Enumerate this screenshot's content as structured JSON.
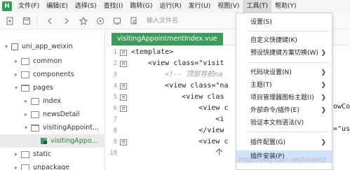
{
  "menubar": {
    "logo": "H",
    "items": [
      "文件(F)",
      "编辑(E)",
      "选择(S)",
      "查找(I)",
      "跳转(G)",
      "运行(R)",
      "发行(U)",
      "视图(V)",
      "工具(T)",
      "帮助(Y)"
    ]
  },
  "toolbar": {
    "search_placeholder": "输入文件名"
  },
  "sidebar": {
    "items": [
      {
        "label": "uni_app_weixin",
        "arrow": "▾",
        "icon": "project"
      },
      {
        "label": "common",
        "arrow": "▸",
        "icon": "folder"
      },
      {
        "label": "components",
        "arrow": "▸",
        "icon": "folder"
      },
      {
        "label": "pages",
        "arrow": "▾",
        "icon": "folder-open"
      },
      {
        "label": "index",
        "arrow": "▸",
        "icon": "folder"
      },
      {
        "label": "newsDetail",
        "arrow": "▸",
        "icon": "folder"
      },
      {
        "label": "visitingAppoint...",
        "arrow": "▾",
        "icon": "folder-open"
      },
      {
        "label": "visitingAppo...",
        "arrow": "",
        "icon": "vue-file"
      },
      {
        "label": "static",
        "arrow": "▸",
        "icon": "folder"
      },
      {
        "label": "unpackage",
        "arrow": "▸",
        "icon": "folder"
      }
    ]
  },
  "editor": {
    "tab_label": "visitingAppointmentIndex.vue",
    "lines": [
      {
        "num": "1",
        "fold": "⊟",
        "text": "<template>",
        "comment": false
      },
      {
        "num": "2",
        "fold": "⊟",
        "text": "    <view class=\"visit",
        "comment": false
      },
      {
        "num": "3",
        "fold": "",
        "text": "        <!-- 顶部导航na",
        "comment": true
      },
      {
        "num": "4",
        "fold": "⊟",
        "text": "        <view class=\"na",
        "comment": false
      },
      {
        "num": "5",
        "fold": "⊟",
        "text": "            <view clas",
        "comment": false
      },
      {
        "num": "6",
        "fold": "⊟",
        "text": "                <view c",
        "comment": false
      },
      {
        "num": "7",
        "fold": "",
        "text": "                    <i",
        "comment": false
      },
      {
        "num": "8",
        "fold": "",
        "text": "                </view",
        "comment": false
      },
      {
        "num": "9",
        "fold": "⊟",
        "text": "                <view c",
        "comment": false
      },
      {
        "num": "10",
        "fold": "",
        "text": "                    个",
        "comment": false
      }
    ],
    "right_clip_1": "owCo",
    "right_clip_2": "=\"us"
  },
  "dropdown": {
    "items": [
      {
        "label": "设置(S)",
        "submenu": false
      },
      {
        "label": "自定义快捷键(K)",
        "submenu": false
      },
      {
        "label": "预设快捷键方案切换(W)",
        "submenu": true
      },
      {
        "label": "代码块设置(N)",
        "submenu": true
      },
      {
        "label": "主题(T)",
        "submenu": true
      },
      {
        "label": "项目管理器图标主题(I)",
        "submenu": true
      },
      {
        "label": "外部命令/插件(E)",
        "submenu": true
      },
      {
        "label": "验证本文档语法(V)",
        "submenu": false
      },
      {
        "label": "插件配置(G)",
        "submenu": true
      },
      {
        "label": "插件安装(P)",
        "submenu": false
      }
    ],
    "arrow_glyph": "❯"
  },
  "watermark": "https://blog.csdn.net/hbiao68",
  "colors": {
    "accent": "#3c9d5b",
    "menu_highlight": "#cfe3ff"
  }
}
